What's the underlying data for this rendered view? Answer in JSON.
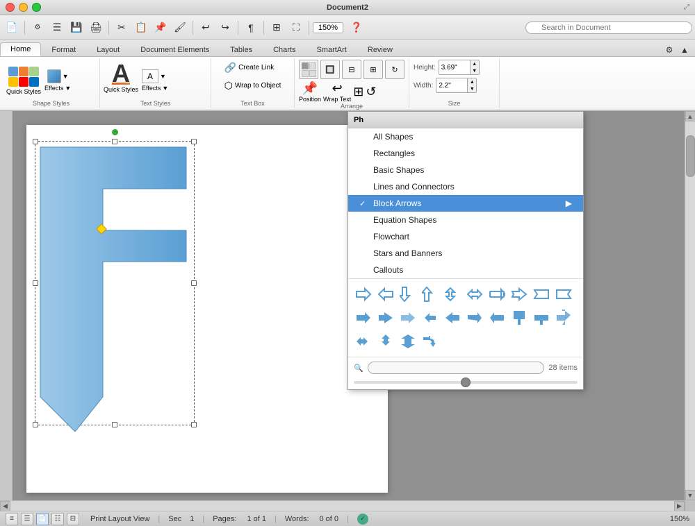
{
  "window": {
    "title": "Document2",
    "zoom": "150%"
  },
  "toolbar": {
    "search_placeholder": "Search in Document"
  },
  "ribbon_tabs": [
    {
      "id": "home",
      "label": "Home",
      "active": true
    },
    {
      "id": "format",
      "label": "Format",
      "active": false
    },
    {
      "id": "layout",
      "label": "Layout",
      "active": false
    },
    {
      "id": "document_elements",
      "label": "Document Elements",
      "active": false
    },
    {
      "id": "tables",
      "label": "Tables",
      "active": false
    },
    {
      "id": "charts",
      "label": "Charts",
      "active": false
    },
    {
      "id": "smartart",
      "label": "SmartArt",
      "active": false
    },
    {
      "id": "review",
      "label": "Review",
      "active": false
    }
  ],
  "ribbon_groups": {
    "shape_styles": {
      "label": "Shape Styles",
      "quick_styles_label": "Quick Styles",
      "effects_label": "Effects"
    },
    "text_styles": {
      "label": "Text Styles",
      "quick_styles_label": "Quick Styles",
      "effects_label": "Effects"
    },
    "text_box": {
      "label": "Text Box",
      "link_label": "Create Link",
      "wrap_label": "Wrap to Object"
    },
    "arrange": {
      "label": "Arrange",
      "position_label": "Position",
      "wrap_text_label": "Wrap Text"
    },
    "size": {
      "label": "Size",
      "height_label": "Height:",
      "height_value": "3.69\"",
      "width_label": "Width:",
      "width_value": "2.2\""
    }
  },
  "shape_panel": {
    "title": "Ph",
    "items": [
      {
        "id": "all_shapes",
        "label": "All Shapes",
        "selected": false,
        "checked": false
      },
      {
        "id": "rectangles",
        "label": "Rectangles",
        "selected": false,
        "checked": false
      },
      {
        "id": "basic_shapes",
        "label": "Basic Shapes",
        "selected": false,
        "checked": false
      },
      {
        "id": "lines_connectors",
        "label": "Lines and Connectors",
        "selected": false,
        "checked": false
      },
      {
        "id": "block_arrows",
        "label": "Block Arrows",
        "selected": true,
        "checked": true
      },
      {
        "id": "equation_shapes",
        "label": "Equation Shapes",
        "selected": false,
        "checked": false
      },
      {
        "id": "flowchart",
        "label": "Flowchart",
        "selected": false,
        "checked": false
      },
      {
        "id": "stars_banners",
        "label": "Stars and Banners",
        "selected": false,
        "checked": false
      },
      {
        "id": "callouts",
        "label": "Callouts",
        "selected": false,
        "checked": false
      }
    ],
    "item_count": "28 items",
    "search_placeholder": ""
  },
  "statusbar": {
    "view_label": "Print Layout View",
    "sec_label": "Sec",
    "sec_value": "1",
    "pages_label": "Pages:",
    "pages_value": "1 of 1",
    "words_label": "Words:",
    "words_value": "0 of 0",
    "zoom_value": "150%"
  },
  "icons": {
    "close": "✕",
    "minimize": "–",
    "maximize": "⬤",
    "search": "🔍",
    "arrow_up": "▲",
    "arrow_down": "▼",
    "arrow_left": "◀",
    "arrow_right": "▶",
    "check": "✓",
    "dropdown": "▼"
  }
}
